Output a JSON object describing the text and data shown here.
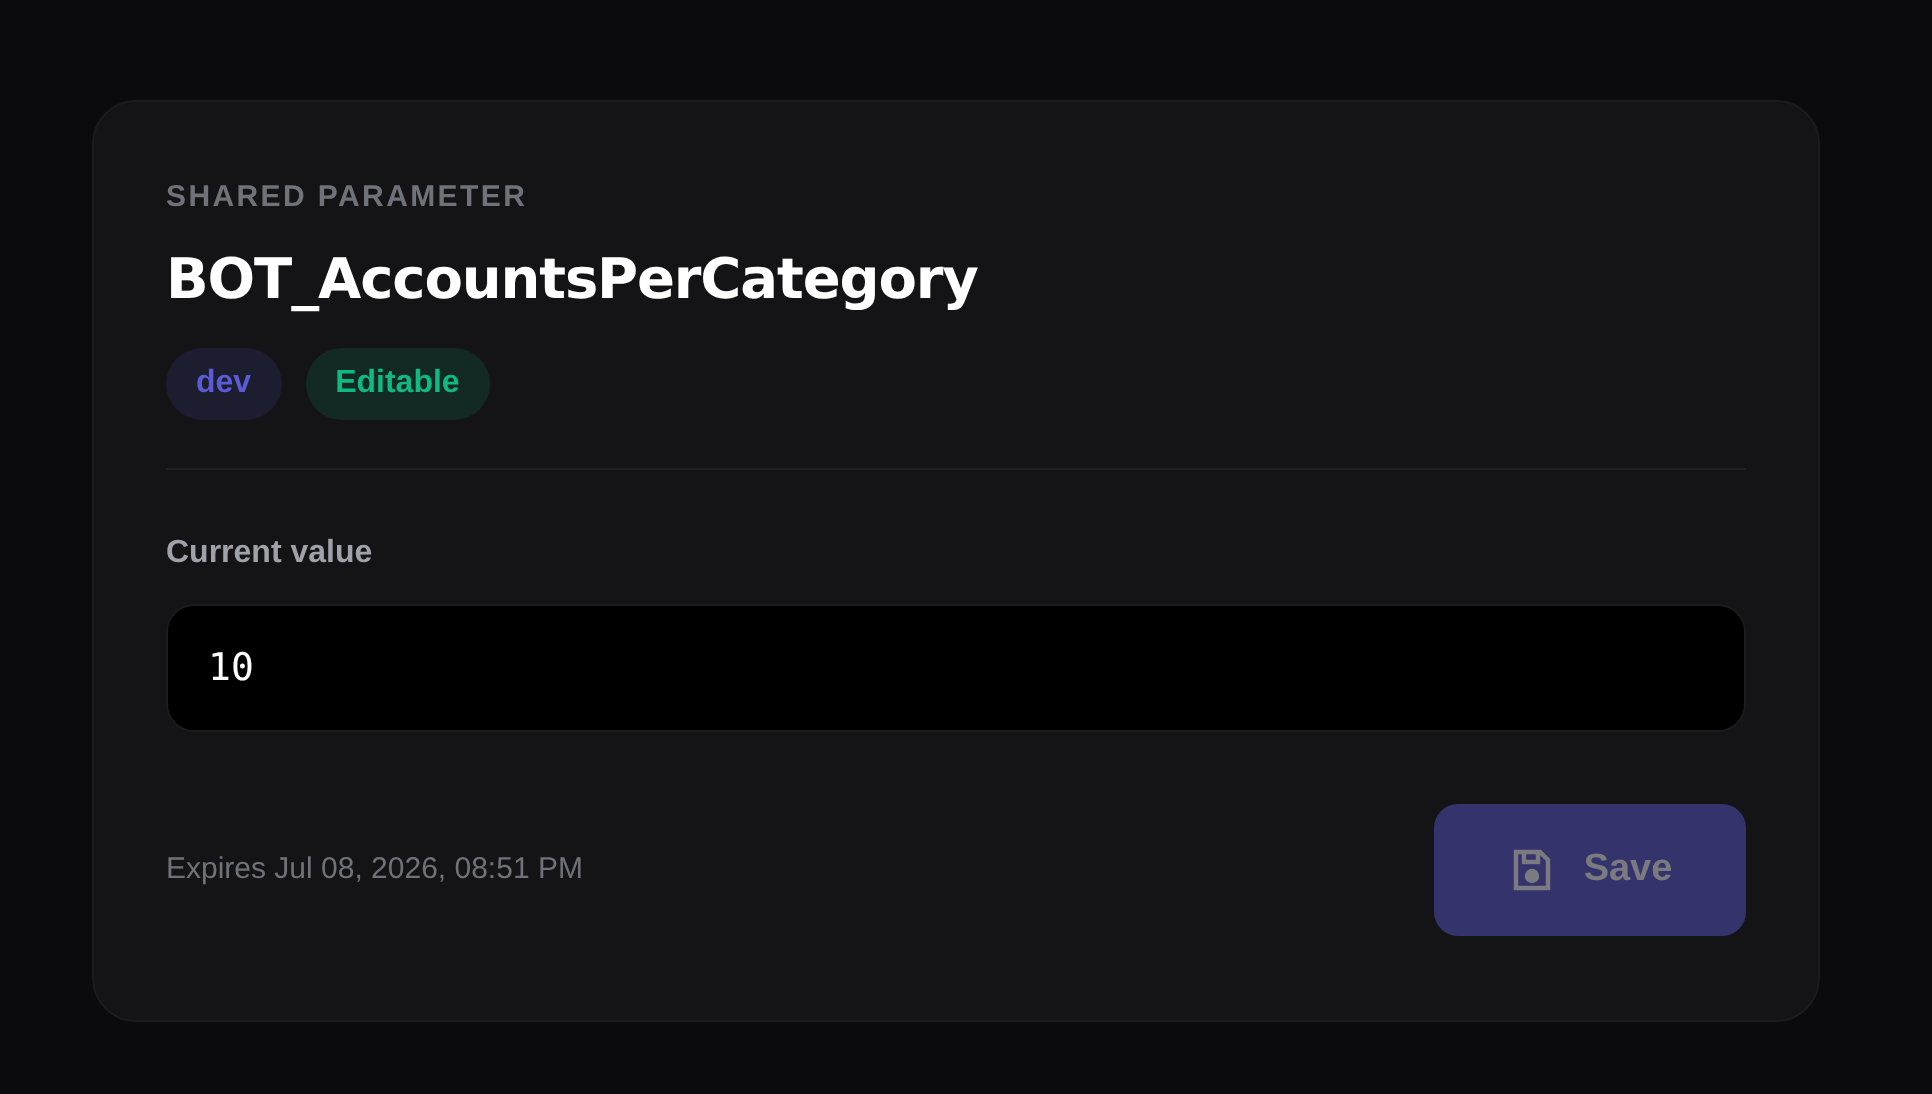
{
  "eyebrow": "SHARED PARAMETER",
  "title": "BOT_AccountsPerCategory",
  "tags": [
    {
      "label": "dev",
      "color": "#5b5bd6"
    },
    {
      "label": "Editable",
      "color": "#10b981"
    }
  ],
  "field": {
    "label": "Current value",
    "value": "10"
  },
  "expires": "Expires Jul 08, 2026, 08:51 PM",
  "save_button": {
    "label": "Save",
    "disabled": true
  }
}
